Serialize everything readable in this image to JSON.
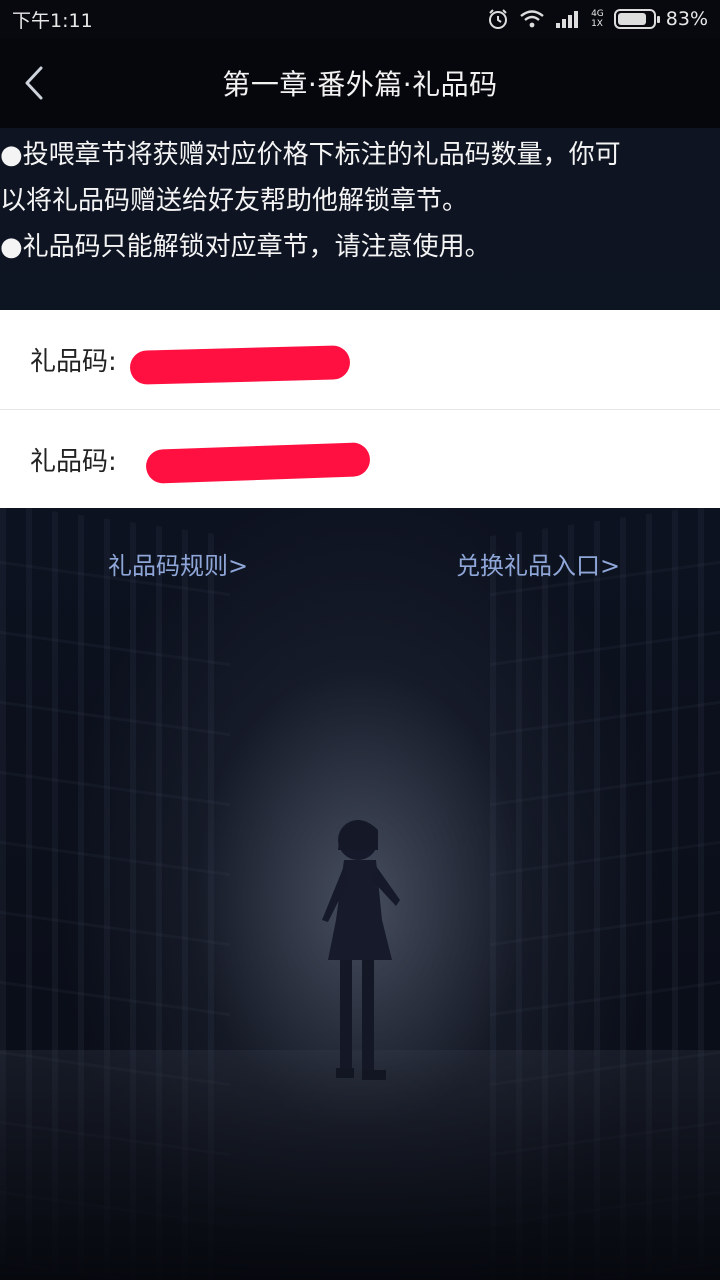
{
  "status_bar": {
    "time": "下午1:11",
    "network": "4G",
    "network_sub": "1X",
    "battery_text": "83%",
    "battery_level": 0.83
  },
  "header": {
    "title": "第一章·番外篇·礼品码"
  },
  "info": {
    "line1": "●投喂章节将获赠对应价格下标注的礼品码数量，你可",
    "line2": "以将礼品码赠送给好友帮助他解锁章节。",
    "line3": "●礼品码只能解锁对应章节，请注意使用。"
  },
  "codes": {
    "label": "礼品码:",
    "items": [
      {
        "value": ""
      },
      {
        "value": ""
      }
    ]
  },
  "links": {
    "rules": "礼品码规则>",
    "redeem": "兑换礼品入口>"
  },
  "colors": {
    "link": "#8fa6d8",
    "redaction": "#ff1040",
    "header_bg": "#05070c"
  }
}
